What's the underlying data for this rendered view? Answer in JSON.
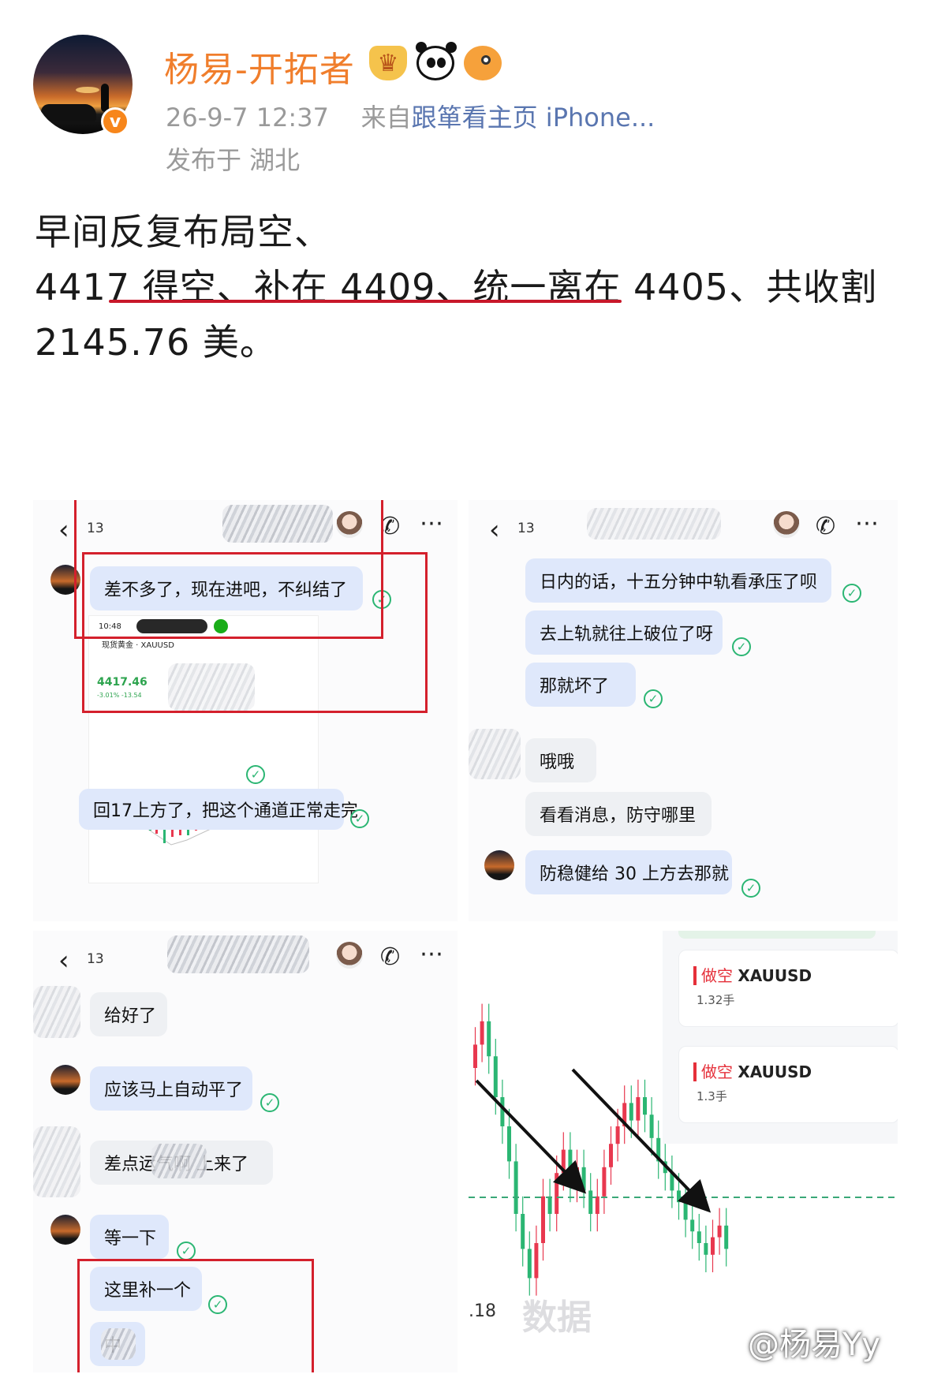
{
  "header": {
    "username": "杨易-开拓者",
    "verified_badge": "v",
    "emoji_icons": [
      "crown-icon",
      "panda-icon",
      "pufferfish-icon"
    ],
    "timestamp": "26-9-7 12:37",
    "source_prefix": "来自",
    "source_text": "跟箪看主页 iPhone...",
    "location": "发布于 湖北"
  },
  "post": {
    "line1": "早间反复布局空、",
    "line2": "4417 得空、补在 4409、统一离在 4405、共收割",
    "line3": "2145.76 美。"
  },
  "panel_top_left": {
    "back_count": "13",
    "messages": [
      "差不多了，现在进吧，不纠结了",
      "回17上方了，把这个通道正常走完"
    ],
    "screenshot": {
      "time": "10:48",
      "instrument": "现货黄金",
      "code": "XAUUSD",
      "price": "4417.46",
      "change": "-3.01%  -13.54"
    }
  },
  "panel_top_right": {
    "back_count": "13",
    "messages": [
      "日内的话，十五分钟中轨看承压了呗",
      "去上轨就往上破位了呀",
      "那就坏了",
      "哦哦",
      "看看消息，防守哪里",
      "防稳健给 30 上方去那就"
    ]
  },
  "panel_bottom_left": {
    "back_count": "13",
    "messages": [
      "给好了",
      "应该马上自动平了",
      "差点运气啊  上来了",
      "等一下",
      "这里补一个",
      "中"
    ]
  },
  "panel_bottom_right": {
    "orders": [
      {
        "side": "做空",
        "symbol": "XAUUSD",
        "lots": "1.32手"
      },
      {
        "side": "做空",
        "symbol": "XAUUSD",
        "lots": "1.3手"
      }
    ],
    "price_label": ".18",
    "stamp": "数据"
  },
  "chart_data": {
    "type": "candlestick",
    "note_colors": {
      "up": "#e8384f",
      "down": "#2bb673",
      "arrow": "#111111",
      "dash": "#3aa877"
    }
  },
  "watermark": "@杨易Yy",
  "colors": {
    "username": "#f07e2c",
    "underline": "#c8182a",
    "bubble_blue": "#dfe8fb",
    "check_green": "#2bb673",
    "highlight_box": "#d4202c"
  }
}
